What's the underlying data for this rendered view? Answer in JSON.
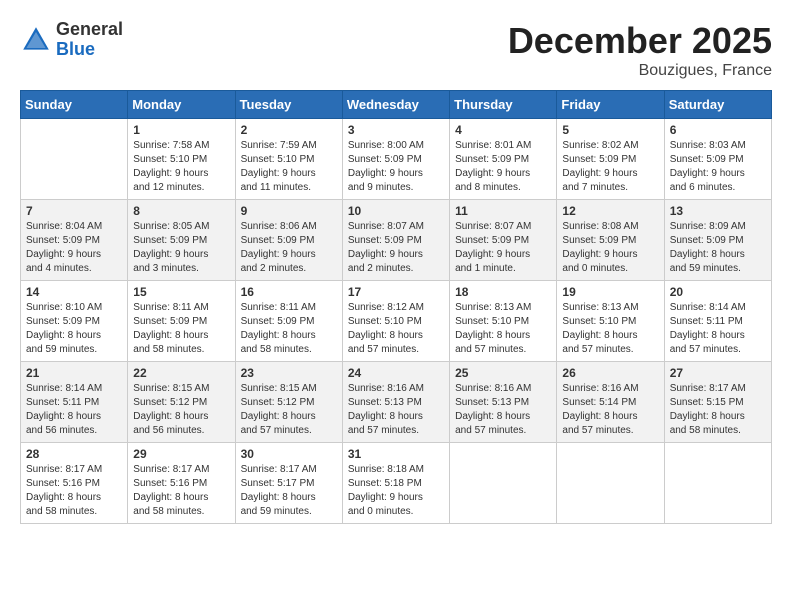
{
  "logo": {
    "general": "General",
    "blue": "Blue"
  },
  "title": "December 2025",
  "location": "Bouzigues, France",
  "headers": [
    "Sunday",
    "Monday",
    "Tuesday",
    "Wednesday",
    "Thursday",
    "Friday",
    "Saturday"
  ],
  "weeks": [
    [
      {
        "day": "",
        "info": ""
      },
      {
        "day": "1",
        "info": "Sunrise: 7:58 AM\nSunset: 5:10 PM\nDaylight: 9 hours\nand 12 minutes."
      },
      {
        "day": "2",
        "info": "Sunrise: 7:59 AM\nSunset: 5:10 PM\nDaylight: 9 hours\nand 11 minutes."
      },
      {
        "day": "3",
        "info": "Sunrise: 8:00 AM\nSunset: 5:09 PM\nDaylight: 9 hours\nand 9 minutes."
      },
      {
        "day": "4",
        "info": "Sunrise: 8:01 AM\nSunset: 5:09 PM\nDaylight: 9 hours\nand 8 minutes."
      },
      {
        "day": "5",
        "info": "Sunrise: 8:02 AM\nSunset: 5:09 PM\nDaylight: 9 hours\nand 7 minutes."
      },
      {
        "day": "6",
        "info": "Sunrise: 8:03 AM\nSunset: 5:09 PM\nDaylight: 9 hours\nand 6 minutes."
      }
    ],
    [
      {
        "day": "7",
        "info": "Sunrise: 8:04 AM\nSunset: 5:09 PM\nDaylight: 9 hours\nand 4 minutes."
      },
      {
        "day": "8",
        "info": "Sunrise: 8:05 AM\nSunset: 5:09 PM\nDaylight: 9 hours\nand 3 minutes."
      },
      {
        "day": "9",
        "info": "Sunrise: 8:06 AM\nSunset: 5:09 PM\nDaylight: 9 hours\nand 2 minutes."
      },
      {
        "day": "10",
        "info": "Sunrise: 8:07 AM\nSunset: 5:09 PM\nDaylight: 9 hours\nand 2 minutes."
      },
      {
        "day": "11",
        "info": "Sunrise: 8:07 AM\nSunset: 5:09 PM\nDaylight: 9 hours\nand 1 minute."
      },
      {
        "day": "12",
        "info": "Sunrise: 8:08 AM\nSunset: 5:09 PM\nDaylight: 9 hours\nand 0 minutes."
      },
      {
        "day": "13",
        "info": "Sunrise: 8:09 AM\nSunset: 5:09 PM\nDaylight: 8 hours\nand 59 minutes."
      }
    ],
    [
      {
        "day": "14",
        "info": "Sunrise: 8:10 AM\nSunset: 5:09 PM\nDaylight: 8 hours\nand 59 minutes."
      },
      {
        "day": "15",
        "info": "Sunrise: 8:11 AM\nSunset: 5:09 PM\nDaylight: 8 hours\nand 58 minutes."
      },
      {
        "day": "16",
        "info": "Sunrise: 8:11 AM\nSunset: 5:09 PM\nDaylight: 8 hours\nand 58 minutes."
      },
      {
        "day": "17",
        "info": "Sunrise: 8:12 AM\nSunset: 5:10 PM\nDaylight: 8 hours\nand 57 minutes."
      },
      {
        "day": "18",
        "info": "Sunrise: 8:13 AM\nSunset: 5:10 PM\nDaylight: 8 hours\nand 57 minutes."
      },
      {
        "day": "19",
        "info": "Sunrise: 8:13 AM\nSunset: 5:10 PM\nDaylight: 8 hours\nand 57 minutes."
      },
      {
        "day": "20",
        "info": "Sunrise: 8:14 AM\nSunset: 5:11 PM\nDaylight: 8 hours\nand 57 minutes."
      }
    ],
    [
      {
        "day": "21",
        "info": "Sunrise: 8:14 AM\nSunset: 5:11 PM\nDaylight: 8 hours\nand 56 minutes."
      },
      {
        "day": "22",
        "info": "Sunrise: 8:15 AM\nSunset: 5:12 PM\nDaylight: 8 hours\nand 56 minutes."
      },
      {
        "day": "23",
        "info": "Sunrise: 8:15 AM\nSunset: 5:12 PM\nDaylight: 8 hours\nand 57 minutes."
      },
      {
        "day": "24",
        "info": "Sunrise: 8:16 AM\nSunset: 5:13 PM\nDaylight: 8 hours\nand 57 minutes."
      },
      {
        "day": "25",
        "info": "Sunrise: 8:16 AM\nSunset: 5:13 PM\nDaylight: 8 hours\nand 57 minutes."
      },
      {
        "day": "26",
        "info": "Sunrise: 8:16 AM\nSunset: 5:14 PM\nDaylight: 8 hours\nand 57 minutes."
      },
      {
        "day": "27",
        "info": "Sunrise: 8:17 AM\nSunset: 5:15 PM\nDaylight: 8 hours\nand 58 minutes."
      }
    ],
    [
      {
        "day": "28",
        "info": "Sunrise: 8:17 AM\nSunset: 5:16 PM\nDaylight: 8 hours\nand 58 minutes."
      },
      {
        "day": "29",
        "info": "Sunrise: 8:17 AM\nSunset: 5:16 PM\nDaylight: 8 hours\nand 58 minutes."
      },
      {
        "day": "30",
        "info": "Sunrise: 8:17 AM\nSunset: 5:17 PM\nDaylight: 8 hours\nand 59 minutes."
      },
      {
        "day": "31",
        "info": "Sunrise: 8:18 AM\nSunset: 5:18 PM\nDaylight: 9 hours\nand 0 minutes."
      },
      {
        "day": "",
        "info": ""
      },
      {
        "day": "",
        "info": ""
      },
      {
        "day": "",
        "info": ""
      }
    ]
  ]
}
